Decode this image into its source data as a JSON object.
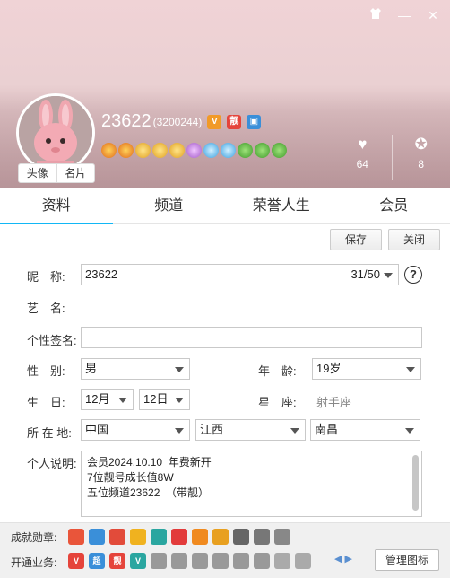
{
  "window": {
    "skin_icon": "shirt-icon",
    "minimize": "—",
    "close": "✕"
  },
  "profile": {
    "avatar_tab": "头像",
    "card_tab": "名片",
    "nickname": "23622",
    "qq_number": "(3200244)",
    "badges": [
      "V",
      "靓"
    ],
    "likes": "64",
    "level": "8"
  },
  "tabs": [
    "资料",
    "频道",
    "荣誉人生",
    "会员"
  ],
  "actions": {
    "save": "保存",
    "close": "关闭"
  },
  "form": {
    "nickname_label": "昵　称:",
    "nickname_value": "23622",
    "nickname_count": "31/50",
    "stage_label": "艺　名:",
    "signature_label": "个性签名:",
    "gender_label": "性　别:",
    "gender_value": "男",
    "age_label": "年　龄:",
    "age_value": "19岁",
    "birthday_label": "生　日:",
    "birth_month": "12月",
    "birth_day": "12日",
    "zodiac_label": "星　座:",
    "zodiac_value": "射手座",
    "location_label": "所 在 地:",
    "country": "中国",
    "province": "江西",
    "city": "南昌",
    "intro_label": "个人说明:",
    "intro_lines": [
      "会员2024.10.10  年费新开",
      "7位靓号成长值8W",
      "五位频道23622  （带靓）"
    ]
  },
  "footer": {
    "medals_label": "成就勋章:",
    "services_label": "开通业务:",
    "manage": "管理图标",
    "pager": "◀ ▶"
  },
  "colors": {
    "accent": "#12b7f5",
    "header": "#e9cfd2"
  }
}
